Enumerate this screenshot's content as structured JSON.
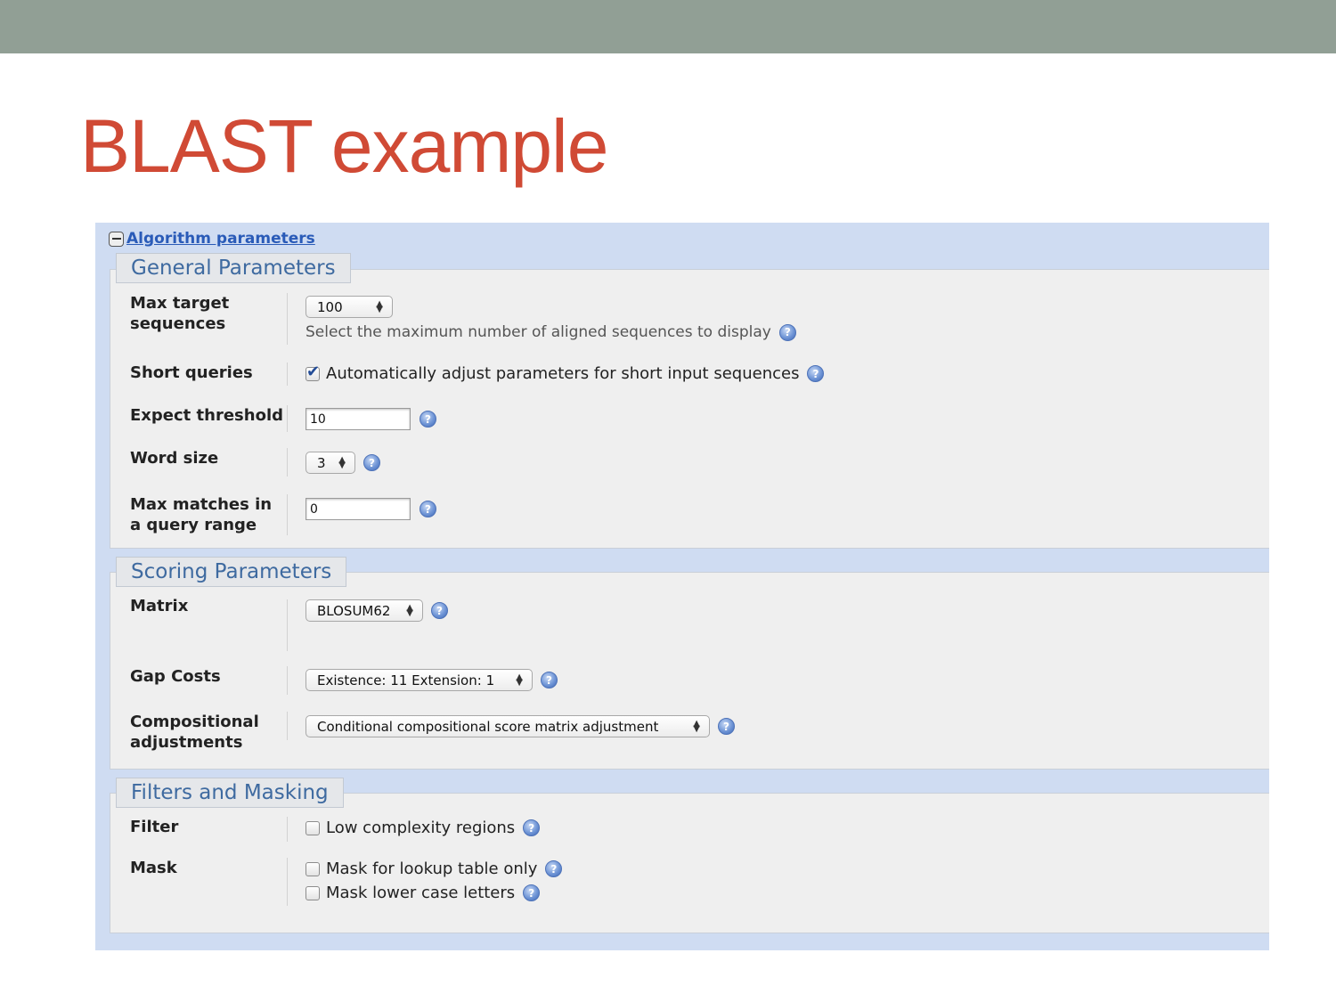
{
  "slide": {
    "title": "BLAST example"
  },
  "form": {
    "section_link": "Algorithm parameters",
    "general": {
      "legend": "General Parameters",
      "max_target_label": "Max target sequences",
      "max_target_value": "100",
      "max_target_hint": "Select the maximum number of aligned sequences to display",
      "short_queries_label": "Short queries",
      "short_queries_text": "Automatically adjust parameters for short input sequences",
      "short_queries_checked": true,
      "expect_label": "Expect threshold",
      "expect_value": "10",
      "word_size_label": "Word size",
      "word_size_value": "3",
      "max_matches_label": "Max matches in a query range",
      "max_matches_value": "0"
    },
    "scoring": {
      "legend": "Scoring Parameters",
      "matrix_label": "Matrix",
      "matrix_value": "BLOSUM62",
      "gap_label": "Gap Costs",
      "gap_value": "Existence: 11 Extension: 1",
      "comp_label": "Compositional adjustments",
      "comp_value": "Conditional compositional score matrix adjustment"
    },
    "filters": {
      "legend": "Filters and Masking",
      "filter_label": "Filter",
      "low_complexity_text": "Low complexity regions",
      "mask_label": "Mask",
      "mask_lookup_text": "Mask for lookup table only",
      "mask_lower_text": "Mask lower case letters"
    }
  },
  "icons": {
    "help": "help-icon",
    "collapse": "collapse-minus-icon",
    "checkbox_check": "check-icon"
  },
  "colors": {
    "title": "#d04a35",
    "topbar": "#919f95",
    "panel_bg": "#cfdcf2",
    "legend_text": "#3e6aa0"
  }
}
